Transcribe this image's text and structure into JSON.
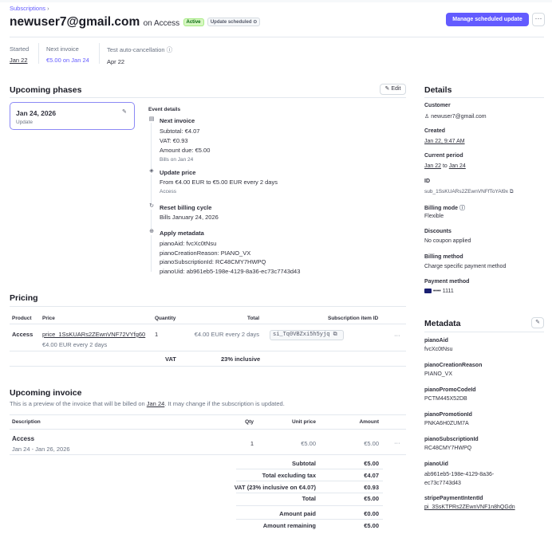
{
  "breadcrumb": {
    "label": "Subscriptions",
    "chevron": "›"
  },
  "header": {
    "customer_email": "newuser7@gmail.com",
    "on_text": "on Access",
    "status_badge": "Active",
    "scheduled_badge": "Update scheduled",
    "primary_button": "Manage scheduled update",
    "more_button": "···"
  },
  "summary": [
    {
      "label": "Started",
      "value": "Jan 22"
    },
    {
      "label": "Next invoice",
      "value": "€5.00 on Jan 24"
    },
    {
      "label": "Test auto-cancellation",
      "value": "Apr 22"
    }
  ],
  "upcoming_phases": {
    "title": "Upcoming phases",
    "edit_button": "Edit",
    "phase": {
      "date": "Jan 24, 2026",
      "sub": "Update"
    },
    "event_details_label": "Event details",
    "events": [
      {
        "icon": "invoice-icon",
        "title": "Next invoice",
        "lines": [
          "Subtotal: €4.07",
          "VAT: €0.93",
          "Amount due: €5.00"
        ],
        "note": "Bills on Jan 24"
      },
      {
        "icon": "price-icon",
        "title": "Update price",
        "lines": [
          "From €4.00 EUR to €5.00 EUR every 2 days"
        ],
        "note": "Access"
      },
      {
        "icon": "refresh-icon",
        "title": "Reset billing cycle",
        "lines": [
          "Bills January 24, 2026"
        ],
        "note": ""
      },
      {
        "icon": "metadata-icon",
        "title": "Apply metadata",
        "lines": [
          "pianoAid: fvcXc0tNsu",
          "pianoCreationReason: PIANO_VX",
          "pianoSubscriptionId: RC48CMY7HWPQ",
          "pianoUid: ab961eb5-198e-4129-8a36-ec73c7743d43"
        ],
        "note": ""
      }
    ]
  },
  "pricing": {
    "title": "Pricing",
    "headers": {
      "product": "Product",
      "price": "Price",
      "quantity": "Quantity",
      "total": "Total",
      "item_id": "Subscription item ID"
    },
    "row": {
      "product": "Access",
      "price_id": "price_1SsKUARs2ZEwnVNF72VYfg60",
      "price_sub": "€4.00 EUR every 2 days",
      "quantity": "1",
      "total": "€4.00 EUR every 2 days",
      "item_id": "si_Tq0VBZxi5h5yjq"
    },
    "vat_label": "VAT",
    "vat_value": "23% inclusive"
  },
  "upcoming_invoice": {
    "title": "Upcoming invoice",
    "desc_prefix": "This is a preview of the invoice that will be billed on",
    "desc_date": "Jan 24",
    "desc_suffix": ". It may change if the subscription is updated.",
    "headers": {
      "description": "Description",
      "qty": "Qty",
      "unit_price": "Unit price",
      "amount": "Amount"
    },
    "row": {
      "name": "Access",
      "period": "Jan 24 - Jan 26, 2026",
      "qty": "1",
      "unit_price": "€5.00",
      "amount": "€5.00"
    },
    "totals": [
      {
        "label": "Subtotal",
        "value": "€5.00"
      },
      {
        "label": "Total excluding tax",
        "value": "€4.07"
      },
      {
        "label": "VAT (23% inclusive on €4.07)",
        "value": "€0.93"
      },
      {
        "label": "Total",
        "value": "€5.00"
      }
    ],
    "paid": [
      {
        "label": "Amount paid",
        "value": "€0.00"
      },
      {
        "label": "Amount remaining",
        "value": "€5.00"
      }
    ]
  },
  "details": {
    "title": "Details",
    "customer_label": "Customer",
    "customer_value": "newuser7@gmail.com",
    "created_label": "Created",
    "created_value": "Jan 22, 9:47 AM",
    "period_label": "Current period",
    "period_start": "Jan 22",
    "period_to": "to",
    "period_end": "Jan 24",
    "id_label": "ID",
    "id_value": "sub_1SsKUARs2ZEwnVNFfToYAl9x",
    "billing_mode_label": "Billing mode",
    "billing_mode_value": "Flexible",
    "discounts_label": "Discounts",
    "discounts_value": "No coupon applied",
    "billing_method_label": "Billing method",
    "billing_method_value": "Charge specific payment method",
    "payment_method_label": "Payment method",
    "payment_method_value": "•••• 1111"
  },
  "metadata": {
    "title": "Metadata",
    "items": [
      {
        "key": "pianoAid",
        "value": "fvcXc0tNsu"
      },
      {
        "key": "pianoCreationReason",
        "value": "PIANO_VX"
      },
      {
        "key": "pianoPromoCodeId",
        "value": "PCTM445X52DB"
      },
      {
        "key": "pianoPromotionId",
        "value": "PNKA6H0ZUM7A"
      },
      {
        "key": "pianoSubscriptionId",
        "value": "RC48CMY7HWPQ"
      },
      {
        "key": "pianoUid",
        "value": "ab961eb5-198e-4129-8a36-ec73c7743d43"
      },
      {
        "key": "stripePaymentIntentId",
        "value": "pi_3SsKTPRs2ZEwnVNF1n8hQGdn"
      }
    ]
  }
}
